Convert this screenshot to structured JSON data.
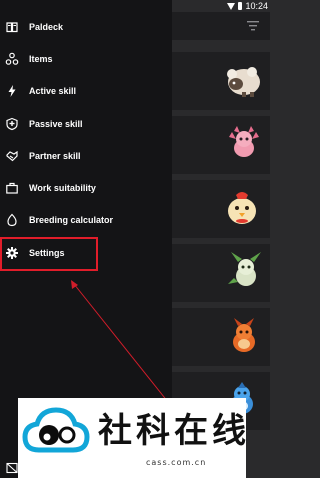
{
  "status_bar": {
    "time": "10:24"
  },
  "drawer": {
    "items": [
      {
        "label": "Paldeck",
        "icon": "book-icon"
      },
      {
        "label": "Items",
        "icon": "items-icon"
      },
      {
        "label": "Active skill",
        "icon": "lightning-icon"
      },
      {
        "label": "Passive skill",
        "icon": "passive-skill-icon"
      },
      {
        "label": "Partner skill",
        "icon": "handshake-icon"
      },
      {
        "label": "Work suitability",
        "icon": "briefcase-icon"
      },
      {
        "label": "Breeding calculator",
        "icon": "egg-icon"
      },
      {
        "label": "Settings",
        "icon": "gear-icon"
      }
    ],
    "highlighted_item": "Settings"
  },
  "colors": {
    "drawer_bg": "#141416",
    "content_bg": "#2a2a2c",
    "highlight": "#e11d2a",
    "text": "#ffffff"
  },
  "watermark": {
    "title": "社科在线",
    "url": "cass.com.cn"
  }
}
